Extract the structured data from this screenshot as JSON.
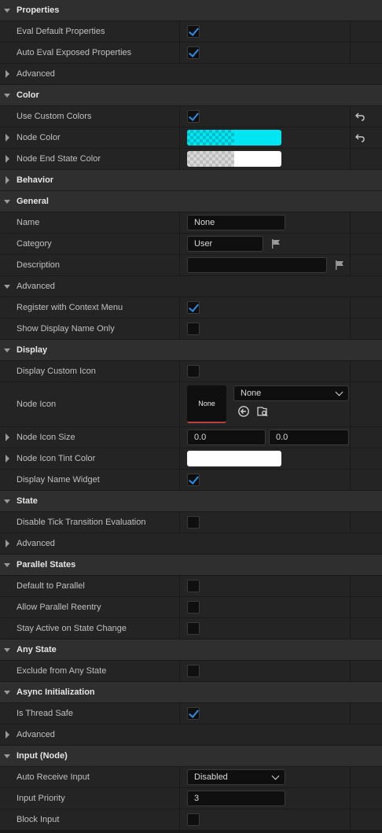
{
  "categories": {
    "properties": "Properties",
    "color": "Color",
    "behavior": "Behavior",
    "general": "General",
    "display": "Display",
    "state": "State",
    "parallel_states": "Parallel States",
    "any_state": "Any State",
    "async_init": "Async Initialization",
    "input_node": "Input (Node)"
  },
  "labels": {
    "eval_default": "Eval Default Properties",
    "auto_eval": "Auto Eval Exposed Properties",
    "advanced": "Advanced",
    "use_custom_colors": "Use Custom Colors",
    "node_color": "Node Color",
    "node_end_state_color": "Node End State Color",
    "name": "Name",
    "category": "Category",
    "description": "Description",
    "register_context": "Register with Context Menu",
    "show_display_name": "Show Display Name Only",
    "display_custom_icon": "Display Custom Icon",
    "node_icon": "Node Icon",
    "node_icon_size": "Node Icon Size",
    "node_icon_tint": "Node Icon Tint Color",
    "display_name_widget": "Display Name Widget",
    "disable_tick": "Disable Tick Transition Evaluation",
    "default_parallel": "Default to Parallel",
    "allow_parallel_reentry": "Allow Parallel Reentry",
    "stay_active": "Stay Active on State Change",
    "exclude_any_state": "Exclude from Any State",
    "thread_safe": "Is Thread Safe",
    "auto_receive_input": "Auto Receive Input",
    "input_priority": "Input Priority",
    "block_input": "Block Input"
  },
  "values": {
    "name": "None",
    "category": "User",
    "description": "",
    "node_icon_thumb": "None",
    "node_icon_asset": "None",
    "node_icon_size_x": "0.0",
    "node_icon_size_y": "0.0",
    "auto_receive_input": "Disabled",
    "input_priority": "3"
  },
  "checks": {
    "eval_default": true,
    "auto_eval": true,
    "use_custom_colors": true,
    "register_context": true,
    "show_display_name": false,
    "display_custom_icon": false,
    "display_name_widget": true,
    "disable_tick": false,
    "default_parallel": false,
    "allow_parallel_reentry": false,
    "stay_active": false,
    "exclude_any_state": false,
    "thread_safe": true,
    "block_input": false
  },
  "colors": {
    "node_color": "#00e5f2",
    "node_end_state_color": "#ffffff",
    "node_icon_tint": "#ffffff",
    "checkmark": "#2d8ee8",
    "thumb_underline": "#b84040"
  },
  "icons": {
    "reset": "reset-arrow-icon",
    "flag": "flag-icon",
    "use_selected": "arrow-left-circle-icon",
    "browse": "browse-asset-icon"
  }
}
